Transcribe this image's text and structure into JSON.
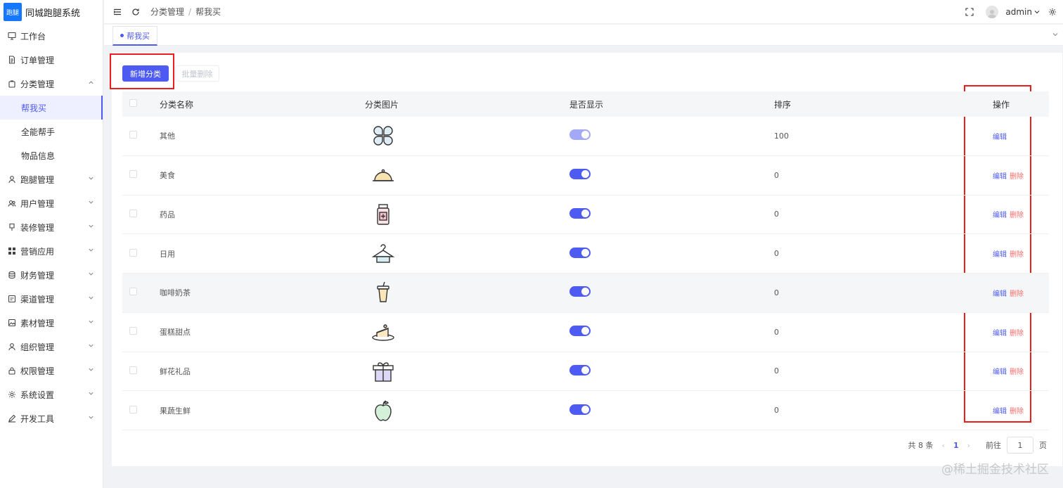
{
  "brand": {
    "logo_text": "跑腿",
    "name": "同城跑腿系统"
  },
  "sidebar": {
    "items": [
      {
        "label": "工作台",
        "icon": "monitor-icon",
        "expandable": false
      },
      {
        "label": "订单管理",
        "icon": "document-icon",
        "expandable": false
      },
      {
        "label": "分类管理",
        "icon": "bag-icon",
        "expandable": true,
        "expanded": true,
        "children": [
          {
            "label": "帮我买",
            "active": true
          },
          {
            "label": "全能帮手",
            "active": false
          },
          {
            "label": "物品信息",
            "active": false
          }
        ]
      },
      {
        "label": "跑腿管理",
        "icon": "user-icon",
        "expandable": true
      },
      {
        "label": "用户管理",
        "icon": "users-icon",
        "expandable": true
      },
      {
        "label": "装修管理",
        "icon": "brush-icon",
        "expandable": true
      },
      {
        "label": "营销应用",
        "icon": "grid-icon",
        "expandable": true
      },
      {
        "label": "财务管理",
        "icon": "database-icon",
        "expandable": true
      },
      {
        "label": "渠道管理",
        "icon": "channel-icon",
        "expandable": true
      },
      {
        "label": "素材管理",
        "icon": "image-icon",
        "expandable": true
      },
      {
        "label": "组织管理",
        "icon": "person-icon",
        "expandable": true
      },
      {
        "label": "权限管理",
        "icon": "lock-icon",
        "expandable": true
      },
      {
        "label": "系统设置",
        "icon": "gear-icon",
        "expandable": true
      },
      {
        "label": "开发工具",
        "icon": "pen-icon",
        "expandable": true
      }
    ]
  },
  "header": {
    "breadcrumb": [
      "分类管理",
      "帮我买"
    ],
    "breadcrumb_sep": "/",
    "username": "admin"
  },
  "tabs": [
    {
      "label": "帮我买",
      "active": true
    }
  ],
  "toolbar": {
    "add_label": "新增分类",
    "batch_delete_label": "批量删除"
  },
  "table": {
    "columns": [
      "分类名称",
      "分类图片",
      "是否显示",
      "排序",
      "操作"
    ],
    "rows": [
      {
        "name": "其他",
        "icon": "clover-icon",
        "shown": true,
        "sort": "100",
        "ops": [
          "编辑"
        ]
      },
      {
        "name": "美食",
        "icon": "food-cloche-icon",
        "shown": true,
        "sort": "0",
        "ops": [
          "编辑",
          "删除"
        ]
      },
      {
        "name": "药品",
        "icon": "medicine-bottle-icon",
        "shown": true,
        "sort": "0",
        "ops": [
          "编辑",
          "删除"
        ]
      },
      {
        "name": "日用",
        "icon": "hanger-icon",
        "shown": true,
        "sort": "0",
        "ops": [
          "编辑",
          "删除"
        ]
      },
      {
        "name": "咖啡奶茶",
        "icon": "drink-cup-icon",
        "shown": true,
        "sort": "0",
        "ops": [
          "编辑",
          "删除"
        ]
      },
      {
        "name": "蛋糕甜点",
        "icon": "cake-icon",
        "shown": true,
        "sort": "0",
        "ops": [
          "编辑",
          "删除"
        ]
      },
      {
        "name": "鲜花礼品",
        "icon": "gift-icon",
        "shown": true,
        "sort": "0",
        "ops": [
          "编辑",
          "删除"
        ]
      },
      {
        "name": "果蔬生鲜",
        "icon": "apple-icon",
        "shown": true,
        "sort": "0",
        "ops": [
          "编辑",
          "删除"
        ]
      }
    ]
  },
  "pagination": {
    "total_text": "共 8 条",
    "current_page": "1",
    "goto_label": "前往",
    "goto_value": "1",
    "page_suffix": "页"
  },
  "watermark": "@稀土掘金技术社区",
  "colors": {
    "primary": "#4e5bf2",
    "danger": "#f56c6c",
    "annotation_red": "#ee1c1c"
  }
}
